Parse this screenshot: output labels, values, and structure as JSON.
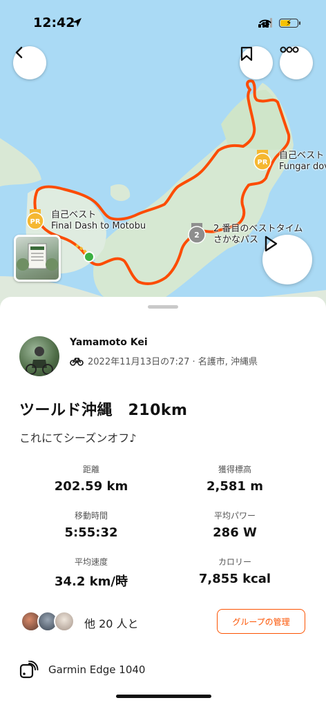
{
  "status_bar": {
    "time": "12:42"
  },
  "map": {
    "labels": {
      "segment_final_dash_badge": "自己ベスト",
      "segment_final_dash_name": "Final Dash to Motobu",
      "segment_fungar_badge": "自己ベスト",
      "segment_fungar_name": "Fungar dov",
      "segment_sakana_badge": "2 番目のベストタイム",
      "segment_sakana_name": "さかなパス",
      "pr_text": "PR",
      "rank2_text": "2"
    },
    "route_color": "#fc4c02",
    "pr_color": "#f5b731"
  },
  "athlete": {
    "name": "Yamamoto Kei",
    "meta": "2022年11月13日の7:27 · 名護市, 沖縄県"
  },
  "activity": {
    "title": "ツールド沖縄　210km",
    "description": "これにてシーズンオフ♪"
  },
  "stats": [
    {
      "label": "距離",
      "value": "202.59 km"
    },
    {
      "label": "獲得標高",
      "value": "2,581 m"
    },
    {
      "label": "移動時間",
      "value": "5:55:32"
    },
    {
      "label": "平均パワー",
      "value": "286 W"
    },
    {
      "label": "平均速度",
      "value": "34.2 km/時"
    },
    {
      "label": "カロリー",
      "value": "7,855 kcal"
    }
  ],
  "group": {
    "others_text": "他 20 人と",
    "manage_button": "グループの管理"
  },
  "device": {
    "name": "Garmin Edge 1040"
  },
  "accent_color": "#fc5200"
}
